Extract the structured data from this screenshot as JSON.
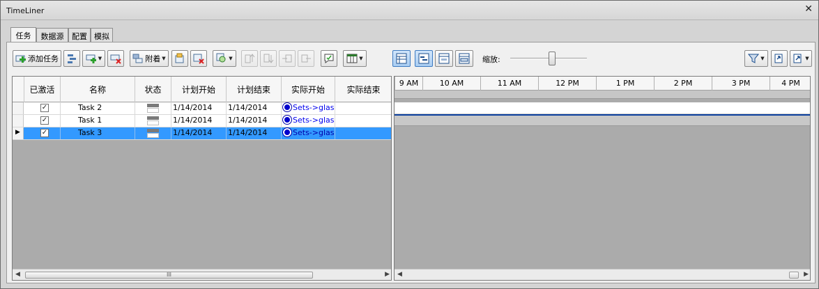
{
  "window": {
    "title": "TimeLiner",
    "close_glyph": "✕"
  },
  "tabs": [
    {
      "label": "任务",
      "active": true
    },
    {
      "label": "数据源",
      "active": false
    },
    {
      "label": "配置",
      "active": false
    },
    {
      "label": "模拟",
      "active": false
    }
  ],
  "toolbar": {
    "add_task_label": "添加任务",
    "attach_label": "附着",
    "zoom_label": "缩放:",
    "zoom_level": 0.55,
    "icons": [
      "add-task-icon",
      "auto-add-tasks-icon",
      "insert-task-icon",
      "delete-task-icon",
      "attach-icon",
      "auto-attach-icon",
      "clear-attach-icon",
      "find-items-icon",
      "move-up-icon",
      "move-down-icon",
      "indent-icon",
      "outdent-icon",
      "add-comment-icon",
      "columns-icon",
      "show-grid-icon",
      "show-gantt-icon",
      "show-grid-gantt-icon",
      "show-planned-icon",
      "filter-icon",
      "import-icon",
      "export-icon"
    ]
  },
  "grid": {
    "columns": [
      "已激活",
      "名称",
      "状态",
      "计划开始",
      "计划结束",
      "实际开始",
      "实际结束"
    ],
    "rows": [
      {
        "active": true,
        "name": "Task 2",
        "planned_start": "1/14/2014",
        "planned_end": "1/14/2014",
        "attached": "Sets->glass",
        "selected": false,
        "current": false
      },
      {
        "active": true,
        "name": "Task 1",
        "planned_start": "1/14/2014",
        "planned_end": "1/14/2014",
        "attached": "Sets->glass",
        "selected": false,
        "current": false
      },
      {
        "active": true,
        "name": "Task 3",
        "planned_start": "1/14/2014",
        "planned_end": "1/14/2014",
        "attached": "Sets->glass",
        "selected": true,
        "current": true
      }
    ],
    "scroll_thumb_glyph": "III"
  },
  "timeline": {
    "ticks": [
      "9 AM",
      "10 AM",
      "11 AM",
      "12 PM",
      "1 PM",
      "2 PM",
      "3 PM",
      "4 PM"
    ],
    "highlight_color": "#3399ff"
  },
  "colors": {
    "selection": "#3399ff",
    "link": "#0000ee",
    "body_bg": "#ababab"
  }
}
